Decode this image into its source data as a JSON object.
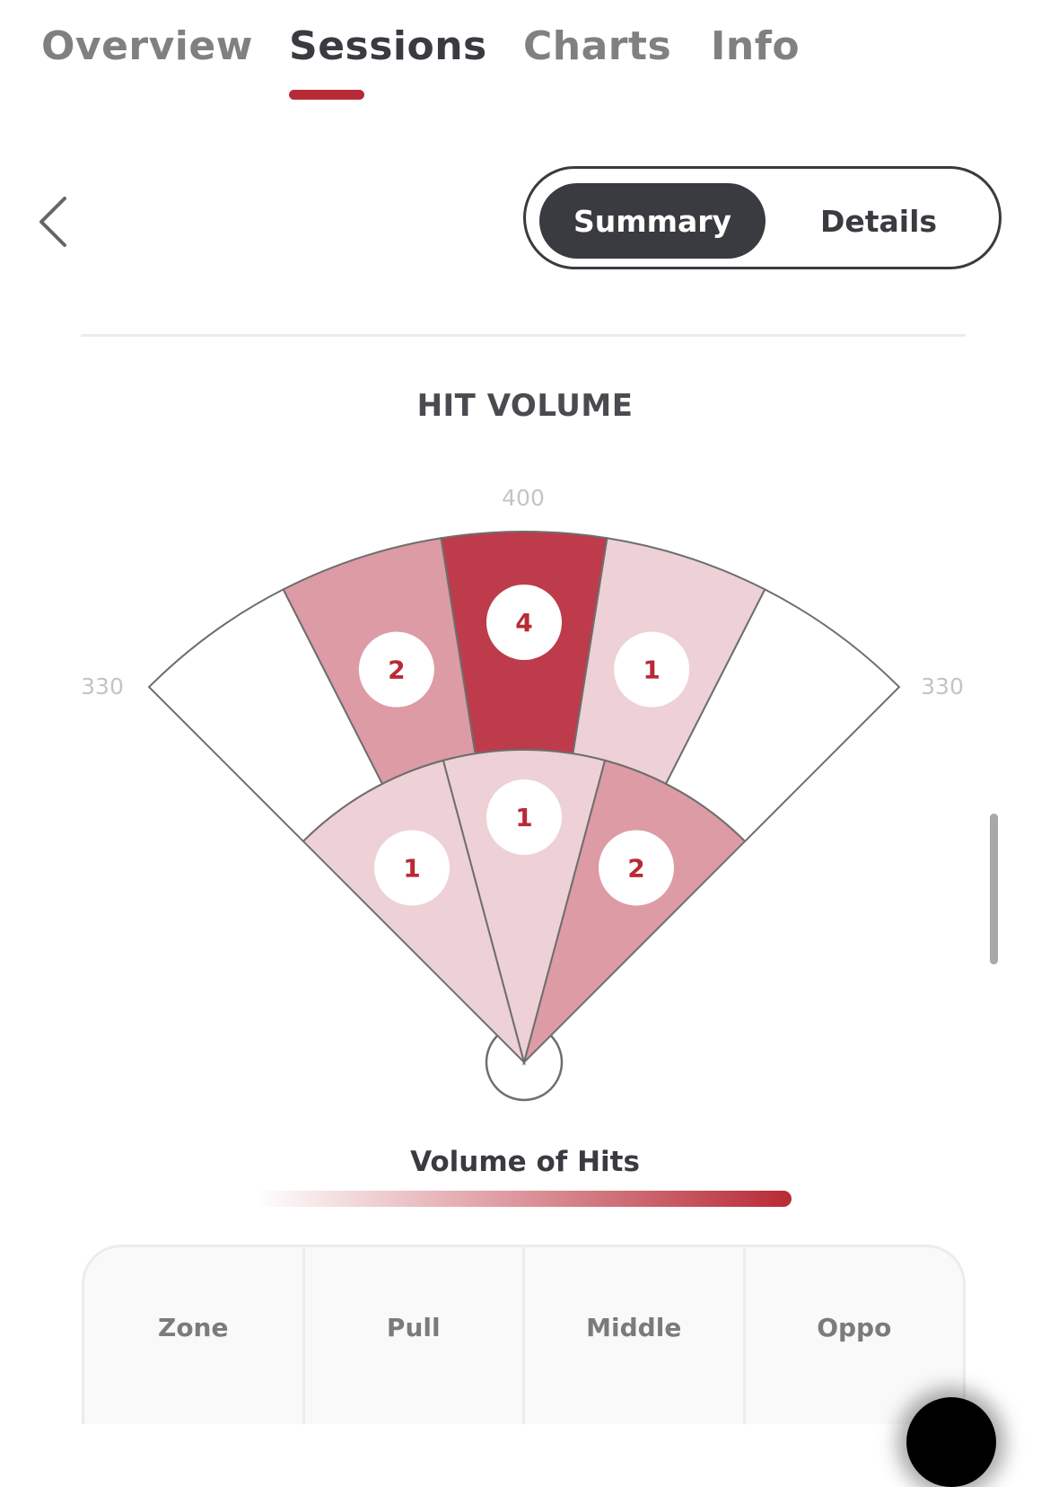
{
  "tabs": [
    {
      "label": "Overview",
      "active": false
    },
    {
      "label": "Sessions",
      "active": true
    },
    {
      "label": "Charts",
      "active": false
    },
    {
      "label": "Info",
      "active": false
    }
  ],
  "accent_color": "#b82a36",
  "view_toggle": {
    "options": [
      "Summary",
      "Details"
    ],
    "selected": "Summary"
  },
  "chart_title": "HIT VOLUME",
  "chart_data": {
    "type": "heatmap",
    "title": "HIT VOLUME",
    "subtype": "spray-chart",
    "fence_distances": {
      "left_field": "330",
      "center_field": "400",
      "right_field": "330"
    },
    "outfield_zones": [
      {
        "zone": "left-line",
        "count": 0
      },
      {
        "zone": "left-center",
        "count": 2
      },
      {
        "zone": "center",
        "count": 4
      },
      {
        "zone": "right-center",
        "count": 1
      },
      {
        "zone": "right-line",
        "count": 0
      }
    ],
    "infield_zones": [
      {
        "zone": "pull",
        "count": 1
      },
      {
        "zone": "middle",
        "count": 1
      },
      {
        "zone": "oppo",
        "count": 2
      }
    ],
    "color_scale": {
      "min_color": "#ffffff",
      "max_color": "#b82a36",
      "levels": {
        "0": "#ffffff",
        "1": "#edd1d6",
        "2": "#dc9ba5",
        "4": "#bd3b4b"
      }
    },
    "legend": "Volume of Hits"
  },
  "legend": {
    "title": "Volume of Hits"
  },
  "table": {
    "headers": [
      "Zone",
      "Pull",
      "Middle",
      "Oppo"
    ]
  }
}
